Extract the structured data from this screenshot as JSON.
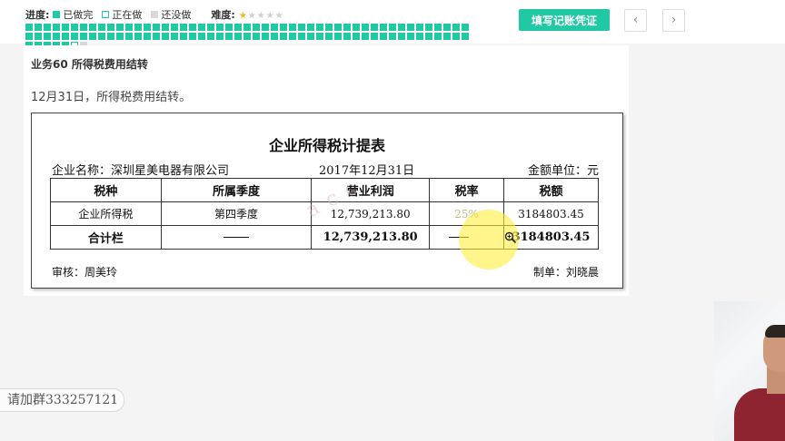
{
  "header": {
    "progress_label": "进度:",
    "legend": [
      {
        "label": "已做完",
        "state": "done"
      },
      {
        "label": "正在做",
        "state": "doing"
      },
      {
        "label": "还没做",
        "state": "todo"
      }
    ],
    "difficulty_label": "难度:",
    "difficulty": {
      "level": 1,
      "max": 5
    },
    "progress_cells": {
      "done": 103,
      "doing": 1,
      "todo": 1
    },
    "fill_button": "填写记账凭证",
    "prev_icon": "chevron-left-icon",
    "next_icon": "chevron-right-icon"
  },
  "task": {
    "title": "业务60 所得税费用结转",
    "description": "12月31日，所得税费用结转。"
  },
  "sheet": {
    "title": "企业所得税计提表",
    "company": "企业名称：深圳星美电器有限公司",
    "date": "2017年12月31日",
    "unit": "金额单位：元",
    "headers": [
      "税种",
      "所属季度",
      "营业利润",
      "税率",
      "税额"
    ],
    "row": {
      "tax_type": "企业所得税",
      "quarter": "第四季度",
      "profit": "12,739,213.80",
      "rate": "25%",
      "amount": "3184803.45"
    },
    "total": {
      "label": "合计栏",
      "profit": "12,739,213.80",
      "amount": "3184803.45"
    },
    "reviewer": "审核：周美玲",
    "maker": "制单：刘晓晨",
    "watermark": "a c c"
  },
  "overlay": {
    "group_text": "请加群333257121",
    "zoom_icon": "magnifier-plus-icon"
  },
  "colors": {
    "accent": "#20c9a3",
    "todo": "#d8d8d8",
    "highlight": "#ffee3c",
    "star": "#f2b81d"
  }
}
